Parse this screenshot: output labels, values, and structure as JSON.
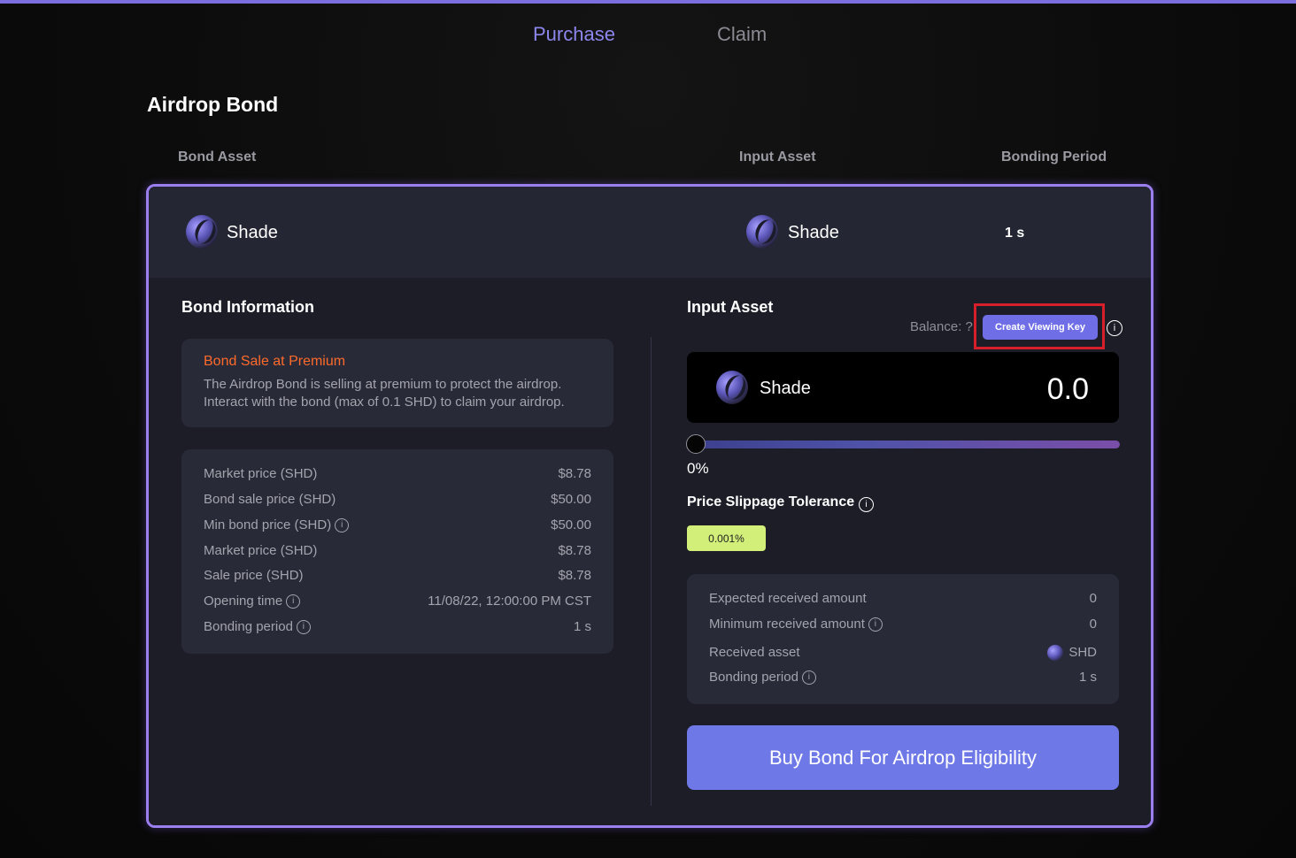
{
  "tabs": [
    {
      "label": "Purchase",
      "active": true
    },
    {
      "label": "Claim",
      "active": false
    }
  ],
  "page_title": "Airdrop Bond",
  "columns": {
    "bond_asset": "Bond Asset",
    "input_asset": "Input Asset",
    "bonding_period": "Bonding Period"
  },
  "header_row": {
    "bond_asset_name": "Shade",
    "input_asset_name": "Shade",
    "bonding_period": "1 s"
  },
  "bond_info": {
    "title": "Bond Information",
    "premium_title": "Bond Sale at Premium",
    "premium_text": "The Airdrop Bond is selling at premium to protect the airdrop. Interact with the bond (max of 0.1 SHD) to claim your airdrop.",
    "rows": [
      {
        "label": "Market price (SHD)",
        "value": "$8.78",
        "info": false
      },
      {
        "label": "Bond sale price (SHD)",
        "value": "$50.00",
        "info": false
      },
      {
        "label": "Min bond price (SHD)",
        "value": "$50.00",
        "info": true
      },
      {
        "label": "Market price (SHD)",
        "value": "$8.78",
        "info": false
      },
      {
        "label": "Sale price (SHD)",
        "value": "$8.78",
        "info": false
      },
      {
        "label": "Opening time",
        "value": "11/08/22, 12:00:00 PM CST",
        "info": true
      },
      {
        "label": "Bonding period",
        "value": "1 s",
        "info": true
      }
    ]
  },
  "input_asset": {
    "title": "Input Asset",
    "balance_label": "Balance: ?",
    "create_viewing_key_label": "Create Viewing Key",
    "asset_name": "Shade",
    "amount": "0.0",
    "slider_percent": "0%",
    "slider_value": 0,
    "slippage_title": "Price Slippage Tolerance",
    "slippage_value": "0.001%"
  },
  "summary": {
    "rows": [
      {
        "label": "Expected received amount",
        "value": "0",
        "info": false
      },
      {
        "label": "Minimum received amount",
        "value": "0",
        "info": true
      },
      {
        "label": "Received asset",
        "value": "SHD",
        "info": false
      },
      {
        "label": "Bonding period",
        "value": "1 s",
        "info": true
      }
    ]
  },
  "buy_button_label": "Buy Bond For Airdrop Eligibility",
  "colors": {
    "accent": "#8d86ec",
    "premium_orange": "#ff6a2b",
    "slippage_pill": "#d2ef7a",
    "buy_button": "#6e78e6",
    "highlight_box": "#d61f2a"
  }
}
